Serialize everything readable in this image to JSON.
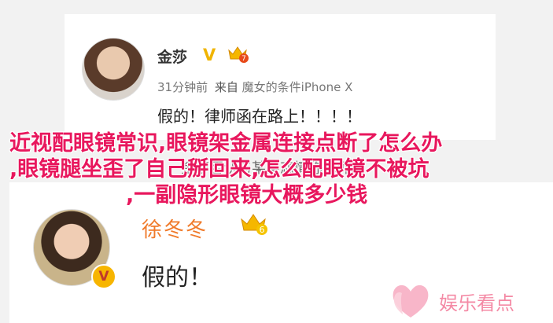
{
  "post1": {
    "username": "金莎",
    "verified_badge": "V",
    "crown_level": "7",
    "time": "31分钟前",
    "source_prefix": "来自",
    "source": "魔女的条件iPhone X",
    "content": "假的！律师函在路上！！！！"
  },
  "post2": {
    "username": "徐冬冬",
    "crown_level": "6",
    "verified_badge": "V",
    "content": "假的！"
  },
  "overlay_title": {
    "line1": "近视配眼镜常识,眼镜架金属连接点断了怎么办",
    "line2": ",眼镜腿坐歪了自己掰回来,怎么配眼镜不被坑",
    "line3": ",一副隐形眼镜大概多少钱"
  },
  "background_caption": "金莎否认与某某恋情称律师函",
  "watermark": {
    "text": "娱乐看点",
    "icon": "heart-icon"
  },
  "colors": {
    "title": "#e8175d",
    "username2": "#f07a2a",
    "gold": "#f0b400",
    "watermark": "#f48aa5"
  }
}
